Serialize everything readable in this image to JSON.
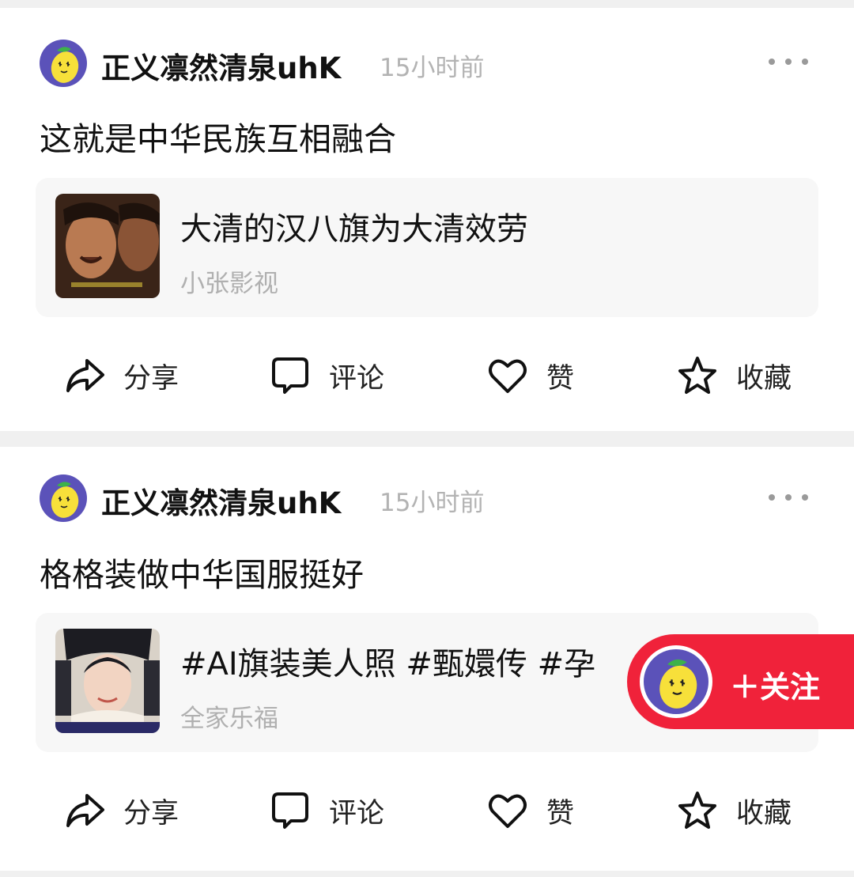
{
  "posts": [
    {
      "username": "正义凛然清泉uhK",
      "time": "15小时前",
      "text": "这就是中华民族互相融合",
      "embed": {
        "title": "大清的汉八旗为大清效劳",
        "source": "小张影视"
      },
      "actions": {
        "share": "分享",
        "comment": "评论",
        "like": "赞",
        "favorite": "收藏"
      }
    },
    {
      "username": "正义凛然清泉uhK",
      "time": "15小时前",
      "text": "格格装做中华国服挺好",
      "embed": {
        "title": "#AI旗装美人照  #甄嬛传 #孕",
        "source": "全家乐福"
      },
      "actions": {
        "share": "分享",
        "comment": "评论",
        "like": "赞",
        "favorite": "收藏"
      }
    }
  ],
  "follow_button": {
    "label": "＋关注"
  },
  "icons": {
    "avatar": "lemon-mascot-icon",
    "more": "more-dots-icon",
    "share": "share-arrow-icon",
    "comment": "comment-bubble-icon",
    "like": "heart-icon",
    "favorite": "star-icon"
  },
  "colors": {
    "follow_bg": "#f0223a",
    "avatar_bg": "#5b52b9",
    "muted_text": "#b3b3b3"
  }
}
